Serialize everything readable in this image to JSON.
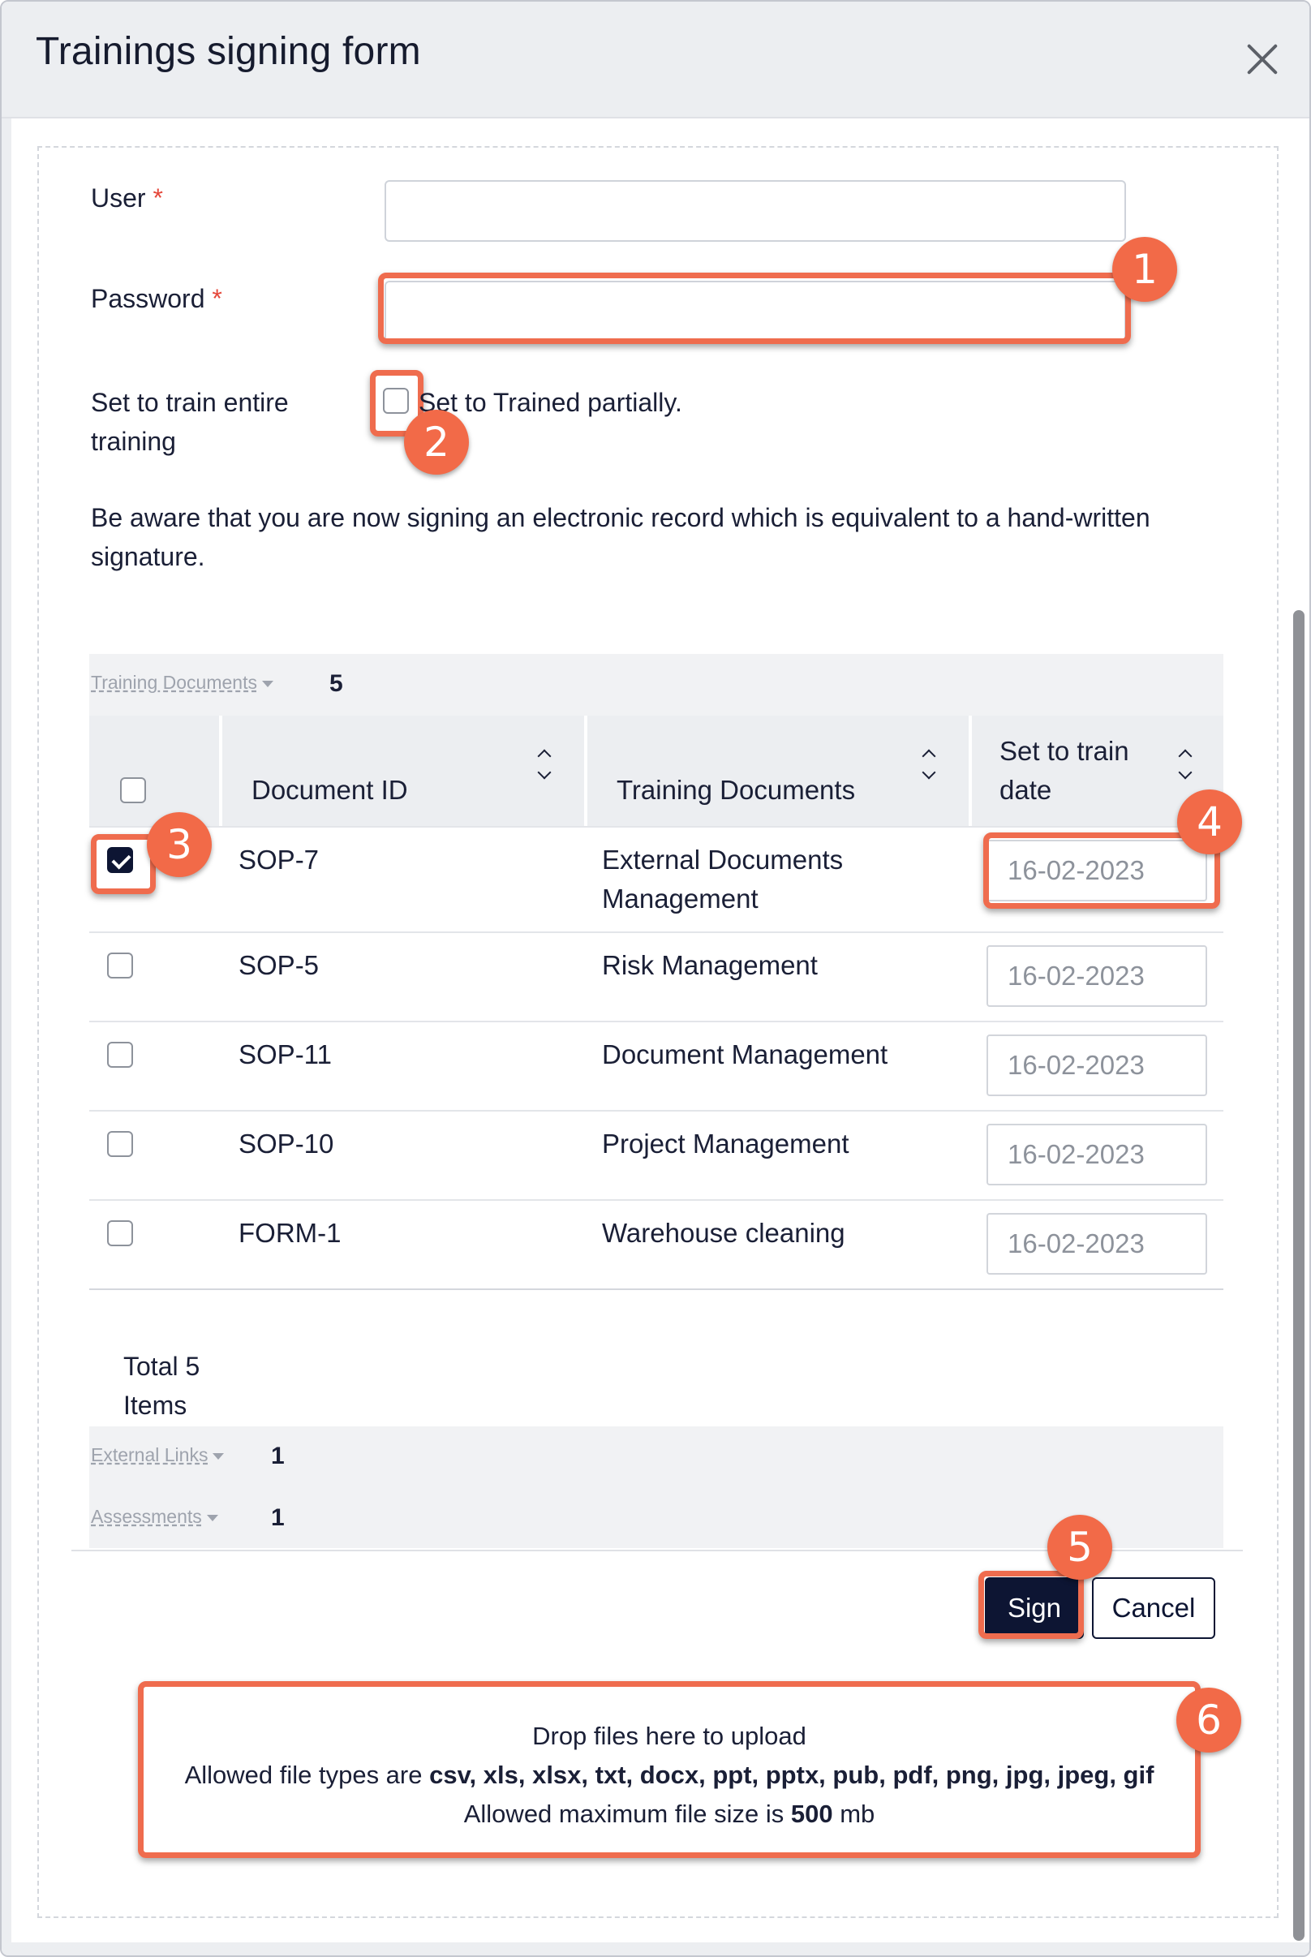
{
  "modal": {
    "title": "Trainings signing form"
  },
  "form": {
    "user_label": "User",
    "password_label": "Password",
    "required_mark": "*",
    "user_value": "",
    "password_value": "",
    "train_entire_label_line1": "Set to train entire",
    "train_entire_label_line2": "training",
    "partial_label": "Set to Trained partially.",
    "warning_line1": "Be aware that you are now signing an electronic record which is equivalent to a hand-written",
    "warning_line2": "signature."
  },
  "training_documents": {
    "section_label": "Training Documents",
    "count": "5",
    "columns": {
      "document_id": "Document ID",
      "training_documents": "Training Documents",
      "set_to_train_date_line1": "Set to train",
      "set_to_train_date_line2": "date"
    },
    "rows": [
      {
        "id": "SOP-7",
        "name_line1": "External Documents",
        "name_line2": "Management",
        "date": "16-02-2023",
        "checked": true
      },
      {
        "id": "SOP-5",
        "name_line1": "Risk Management",
        "name_line2": "",
        "date": "16-02-2023",
        "checked": false
      },
      {
        "id": "SOP-11",
        "name_line1": "Document Management",
        "name_line2": "",
        "date": "16-02-2023",
        "checked": false
      },
      {
        "id": "SOP-10",
        "name_line1": "Project Management",
        "name_line2": "",
        "date": "16-02-2023",
        "checked": false
      },
      {
        "id": "FORM-1",
        "name_line1": "Warehouse cleaning",
        "name_line2": "",
        "date": "16-02-2023",
        "checked": false
      }
    ],
    "total_line1": "Total 5",
    "total_line2": "Items"
  },
  "external_links": {
    "label": "External Links",
    "count": "1"
  },
  "assessments": {
    "label": "Assessments",
    "count": "1"
  },
  "buttons": {
    "sign": "Sign",
    "cancel": "Cancel"
  },
  "upload": {
    "line1": "Drop files here to upload",
    "line2_prefix": "Allowed file types are ",
    "line2_types": "csv, xls, xlsx, txt, docx, ppt, pptx, pub, pdf, png, jpg, jpeg, gif",
    "line3_prefix": "Allowed maximum file size is ",
    "line3_size": "500",
    "line3_suffix": " mb"
  },
  "callouts": [
    "1",
    "2",
    "3",
    "4",
    "5",
    "6"
  ],
  "colors": {
    "accent": "#ef6c4e",
    "badge": "#f26a48",
    "primary": "#0d1533",
    "required": "#e5483b"
  },
  "icons": [
    "close-icon",
    "sort-icon",
    "caret-down-icon",
    "checkbox-checked-icon"
  ]
}
